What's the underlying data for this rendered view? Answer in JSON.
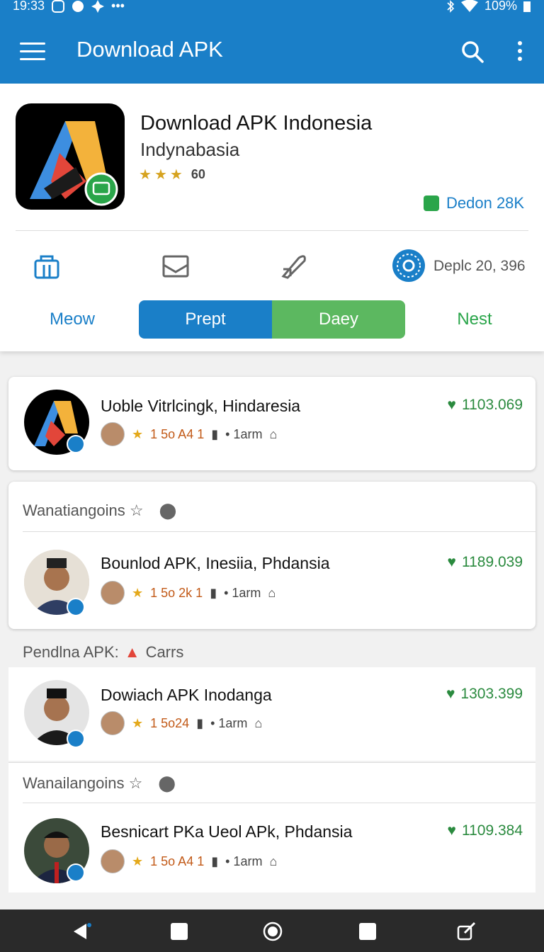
{
  "status": {
    "time": "19:33",
    "battery": "109%"
  },
  "toolbar": {
    "title": "Download APK"
  },
  "app": {
    "title": "Download APK Indonesia",
    "subtitle": "Indynabasia",
    "rating_count": "60",
    "download_label": "Dedon 28K",
    "deploy_label": "Deplc 20, 396"
  },
  "tabs": [
    "Meow",
    "Prept",
    "Daey",
    "Nest"
  ],
  "items": [
    {
      "title": "Uoble  Vitrlcingk, Hindaresia",
      "price": "1103.069",
      "rating": "1 5o A4 1",
      "time": "• 1arm"
    },
    {
      "title": "Bounlod APK, Inesiia, Phdansia",
      "price": "1189.039",
      "rating": "1 5o 2k 1",
      "time": "• 1arm"
    },
    {
      "title": "Dowiach APK Inodanga",
      "price": "1303.399",
      "rating": "1 5o24",
      "time": "• 1arm"
    },
    {
      "title": "Besnicart PKa Ueol APk, Phdansia",
      "price": "1109.384",
      "rating": "1 5o A4 1",
      "time": "• 1arm"
    }
  ],
  "sections": {
    "first": "Wanatiangoins ☆",
    "middle": "Pendlna APK:",
    "middle_suffix": "Carrs",
    "second": "Wanailangoins ☆"
  },
  "colors": {
    "primary": "#1a7fc8",
    "green": "#5cb860",
    "price": "#2a8a3e"
  }
}
